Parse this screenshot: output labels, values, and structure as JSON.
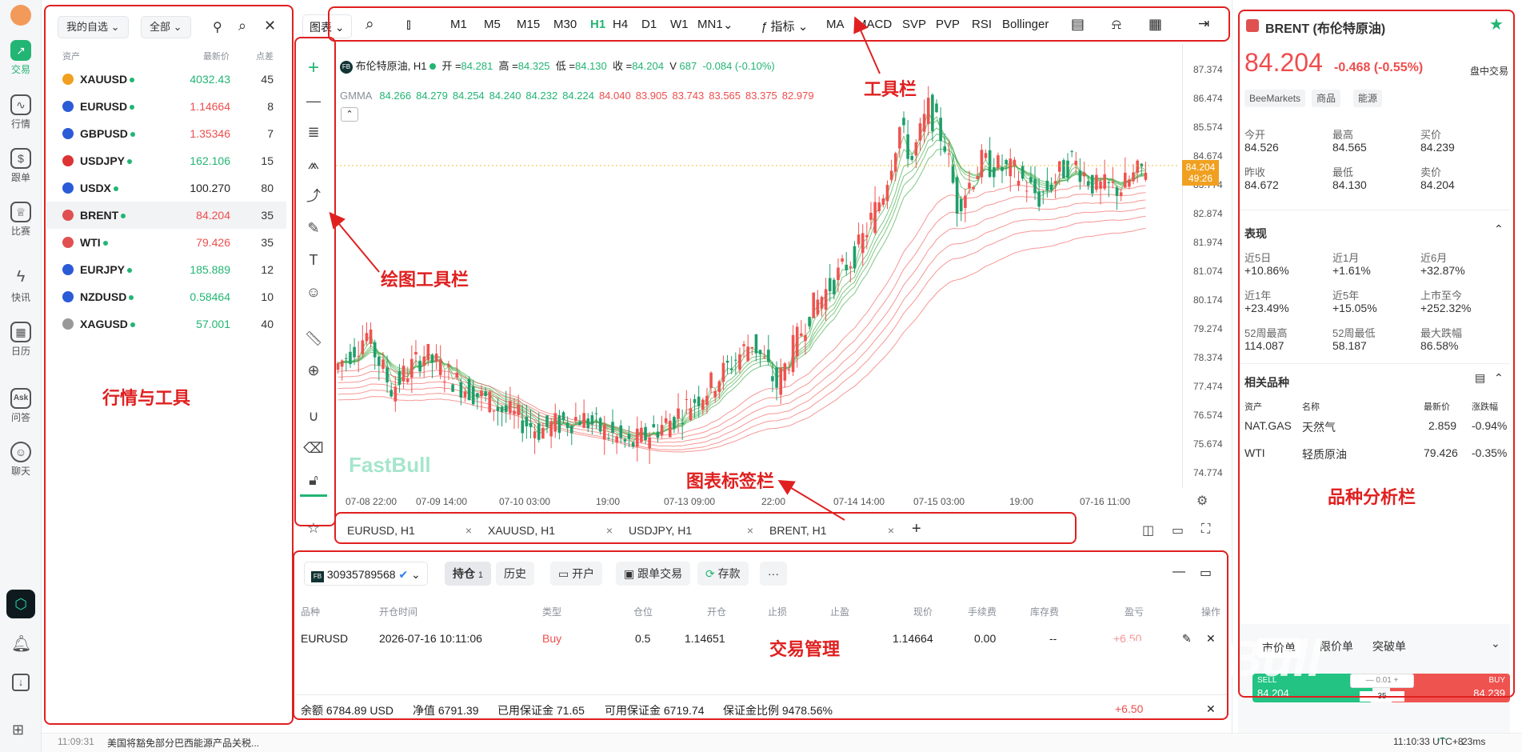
{
  "rail": {
    "items": [
      {
        "label": "交易"
      },
      {
        "label": "行情"
      },
      {
        "label": "跟单"
      },
      {
        "label": "比赛"
      },
      {
        "label": "快讯"
      },
      {
        "label": "日历"
      },
      {
        "label": "问答"
      },
      {
        "label": "聊天"
      }
    ],
    "ask_badge": "Ask"
  },
  "watchlist": {
    "filter1": "我的自选",
    "filter2": "全部",
    "col_asset": "资产",
    "col_price": "最新价",
    "col_spread": "点差",
    "rows": [
      {
        "symbol": "XAUUSD",
        "price": "4032.43",
        "spread": "45",
        "dir": "up",
        "flag": "#f0a020"
      },
      {
        "symbol": "EURUSD",
        "price": "1.14664",
        "spread": "8",
        "dir": "down",
        "flag": "#2b5bd7"
      },
      {
        "symbol": "GBPUSD",
        "price": "1.35346",
        "spread": "7",
        "dir": "down",
        "flag": "#2b5bd7"
      },
      {
        "symbol": "USDJPY",
        "price": "162.106",
        "spread": "15",
        "dir": "up",
        "flag": "#d33"
      },
      {
        "symbol": "USDX",
        "price": "100.270",
        "spread": "80",
        "dir": "flat",
        "flag": "#2b5bd7"
      },
      {
        "symbol": "BRENT",
        "price": "84.204",
        "spread": "35",
        "dir": "down",
        "flag": "#e05050"
      },
      {
        "symbol": "WTI",
        "price": "79.426",
        "spread": "35",
        "dir": "down",
        "flag": "#e05050"
      },
      {
        "symbol": "EURJPY",
        "price": "185.889",
        "spread": "12",
        "dir": "up",
        "flag": "#2b5bd7"
      },
      {
        "symbol": "NZDUSD",
        "price": "0.58464",
        "spread": "10",
        "dir": "up",
        "flag": "#2b5bd7"
      },
      {
        "symbol": "XAGUSD",
        "price": "57.001",
        "spread": "40",
        "dir": "up",
        "flag": "#999999"
      }
    ]
  },
  "annotations": {
    "toolbar": "工具栏",
    "drawing": "绘图工具栏",
    "market": "行情与工具",
    "tabs": "图表标签栏",
    "trade": "交易管理",
    "analysis": "品种分析栏"
  },
  "toolbar": {
    "chart_menu": "图表",
    "timeframes": [
      "M1",
      "M5",
      "M15",
      "M30",
      "H1",
      "H4",
      "D1",
      "W1",
      "MN1"
    ],
    "active_tf": "H1",
    "indicator": "指标",
    "indicators": [
      "MA",
      "MACD",
      "SVP",
      "PVP",
      "RSI",
      "Bollinger"
    ]
  },
  "chart": {
    "title": "布伦特原油, H1",
    "open_label": "开 =",
    "open": "84.281",
    "high_label": "高 =",
    "high": "84.325",
    "low_label": "低 =",
    "low": "84.130",
    "close_label": "收 =",
    "close": "84.204",
    "vol_label": "V",
    "vol": "687",
    "change": "-0.084 (-0.10%)",
    "gmma_label": "GMMA",
    "gmma_green": [
      "84.266",
      "84.279",
      "84.254",
      "84.240",
      "84.232",
      "84.224"
    ],
    "gmma_red": [
      "84.040",
      "83.905",
      "83.743",
      "83.565",
      "83.375",
      "82.979"
    ],
    "watermark": "FastBull",
    "price_tag": "84.204",
    "countdown": "49:26",
    "y_ticks": [
      "87.374",
      "86.474",
      "85.574",
      "84.674",
      "83.774",
      "82.874",
      "81.974",
      "81.074",
      "80.174",
      "79.274",
      "78.374",
      "77.474",
      "76.574",
      "75.674",
      "74.774"
    ],
    "x_ticks": [
      "07-08 22:00",
      "07-09 14:00",
      "07-10 03:00",
      "19:00",
      "07-13 09:00",
      "22:00",
      "07-14 14:00",
      "07-15 03:00",
      "19:00",
      "07-16 11:00"
    ]
  },
  "chart_tabs": [
    "EURUSD, H1",
    "XAUUSD, H1",
    "USDJPY, H1",
    "BRENT, H1"
  ],
  "trade": {
    "account": "30935789568",
    "tabs": [
      "持仓",
      "历史"
    ],
    "positions_count": "1",
    "actions": [
      "开户",
      "跟单交易",
      "存款"
    ],
    "columns": [
      "品种",
      "开仓时间",
      "类型",
      "仓位",
      "开仓",
      "止损",
      "止盈",
      "现价",
      "手续费",
      "库存费",
      "盈亏",
      "操作"
    ],
    "row": {
      "symbol": "EURUSD",
      "time": "2026-07-16 10:11:06",
      "type": "Buy",
      "volume": "0.5",
      "open": "1.14651",
      "price": "1.14664",
      "fee": "0.00",
      "swap": "--",
      "pnl": "+6.50"
    },
    "summary": {
      "balance": "余额 6784.89 USD",
      "equity": "净值 6791.39",
      "used": "已用保证金 71.65",
      "free": "可用保证金 6719.74",
      "ratio": "保证金比例 9478.56%",
      "pnl": "+6.50"
    }
  },
  "panel": {
    "name": "BRENT (布伦特原油)",
    "price": "84.204",
    "change": "-0.468 (-0.55%)",
    "session": "盘中交易",
    "tags": [
      "BeeMarkets",
      "商品",
      "能源"
    ],
    "stats": [
      {
        "label": "今开",
        "value": "84.526"
      },
      {
        "label": "最高",
        "value": "84.565"
      },
      {
        "label": "买价",
        "value": "84.239"
      },
      {
        "label": "昨收",
        "value": "84.672"
      },
      {
        "label": "最低",
        "value": "84.130"
      },
      {
        "label": "卖价",
        "value": "84.204"
      }
    ],
    "perf_title": "表现",
    "perf": [
      {
        "label": "近5日",
        "value": "+10.86%"
      },
      {
        "label": "近1月",
        "value": "+1.61%"
      },
      {
        "label": "近6月",
        "value": "+32.87%"
      },
      {
        "label": "近1年",
        "value": "+23.49%"
      },
      {
        "label": "近5年",
        "value": "+15.05%"
      },
      {
        "label": "上市至今",
        "value": "+252.32%"
      },
      {
        "label": "52周最高",
        "value": "114.087"
      },
      {
        "label": "52周最低",
        "value": "58.187"
      },
      {
        "label": "最大跌幅",
        "value": "86.58%"
      }
    ],
    "related_title": "相关品种",
    "related_cols": [
      "资产",
      "名称",
      "最新价",
      "涨跌幅"
    ],
    "related": [
      {
        "symbol": "NAT.GAS",
        "name": "天然气",
        "price": "2.859",
        "chg": "-0.94%"
      },
      {
        "symbol": "WTI",
        "name": "轻质原油",
        "price": "79.426",
        "chg": "-0.35%"
      }
    ],
    "order_tabs": [
      "市价单",
      "限价单",
      "突破单"
    ],
    "sell": "SELL",
    "sell_price": "84.204",
    "buy": "BUY",
    "buy_price": "84.239",
    "lot": "0.01",
    "spread": "35"
  },
  "status": {
    "news_time": "11:09:31",
    "news": "美国将豁免部分巴西能源产品关税...",
    "clock": "11:10:33 UTC+8",
    "latency": "23ms"
  }
}
